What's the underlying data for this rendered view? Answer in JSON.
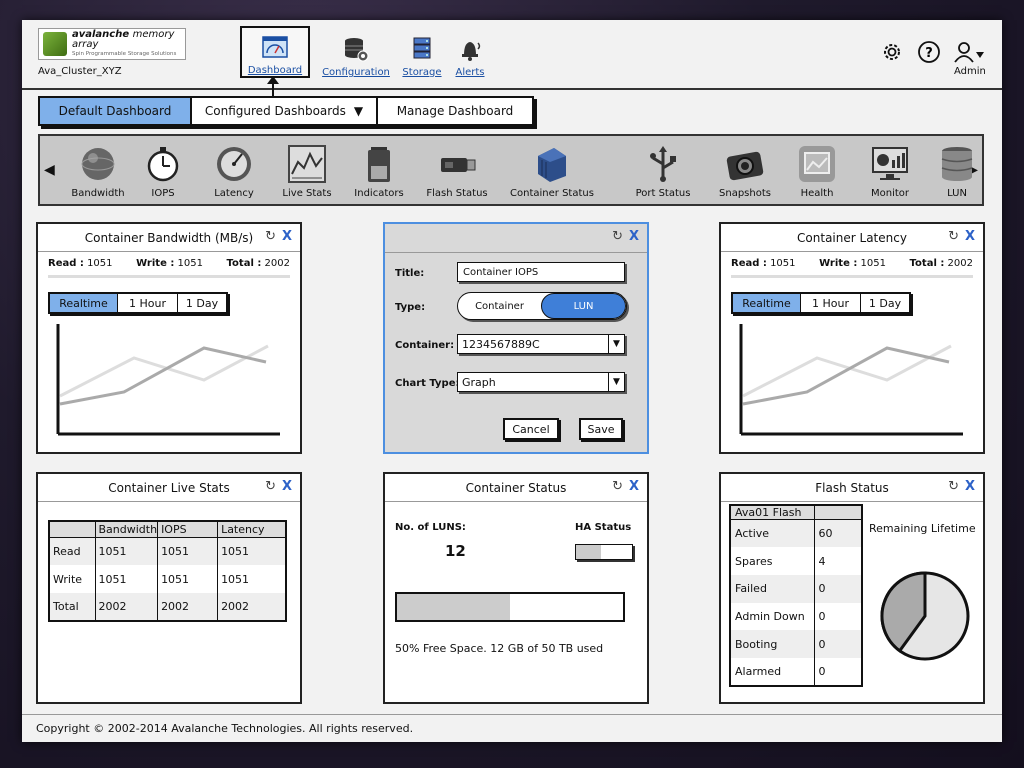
{
  "header": {
    "logo_name": "avalanche",
    "logo_name_suffix": "memory array",
    "logo_tagline": "Spin Programmable Storage Solutions",
    "cluster_name": "Ava_Cluster_XYZ",
    "nav": [
      {
        "label": "Dashboard",
        "icon": "dashboard-icon",
        "active": true
      },
      {
        "label": "Configuration",
        "icon": "database-gear-icon"
      },
      {
        "label": "Storage",
        "icon": "storage-icon"
      },
      {
        "label": "Alerts",
        "icon": "bell-icon"
      }
    ],
    "admin_label": "Admin"
  },
  "tabs": [
    {
      "label": "Default Dashboard",
      "active": true
    },
    {
      "label": "Configured Dashboards",
      "dropdown": true
    },
    {
      "label": "Manage Dashboard"
    }
  ],
  "widgets_bar": [
    {
      "label": "Bandwidth",
      "icon": "sphere-icon"
    },
    {
      "label": "IOPS",
      "icon": "stopwatch-icon"
    },
    {
      "label": "Latency",
      "icon": "gauge-icon"
    },
    {
      "label": "Live Stats",
      "icon": "graph-icon"
    },
    {
      "label": "Indicators",
      "icon": "battery-icon"
    },
    {
      "label": "Flash Status",
      "icon": "usb-drive-icon"
    },
    {
      "label": "Container Status",
      "icon": "container-icon"
    },
    {
      "label": "Port Status",
      "icon": "usb-symbol-icon"
    },
    {
      "label": "Snapshots",
      "icon": "camera-icon"
    },
    {
      "label": "Health",
      "icon": "picture-icon"
    },
    {
      "label": "Monitor",
      "icon": "monitor-chart-icon"
    },
    {
      "label": "LUN",
      "icon": "database-icon"
    }
  ],
  "bandwidth_panel": {
    "title": "Container Bandwidth (MB/s)",
    "read_label": "Read :",
    "read_value": "1051",
    "write_label": "Write :",
    "write_value": "1051",
    "total_label": "Total :",
    "total_value": "2002",
    "ranges": [
      "Realtime",
      "1 Hour",
      "1 Day"
    ]
  },
  "latency_panel": {
    "title": "Container Latency",
    "read_label": "Read :",
    "read_value": "1051",
    "write_label": "Write :",
    "write_value": "1051",
    "total_label": "Total :",
    "total_value": "2002",
    "ranges": [
      "Realtime",
      "1 Hour",
      "1 Day"
    ]
  },
  "config_panel": {
    "title_label": "Title:",
    "title_value": "Container IOPS",
    "type_label": "Type:",
    "type_options": [
      "Container",
      "LUN"
    ],
    "type_selected": "LUN",
    "container_label": "Container:",
    "container_value": "1234567889C",
    "chart_type_label": "Chart Type:",
    "chart_type_value": "Graph",
    "cancel_label": "Cancel",
    "save_label": "Save"
  },
  "live_stats_panel": {
    "title": "Container Live Stats",
    "columns": [
      "",
      "Bandwidth",
      "IOPS",
      "Latency"
    ],
    "rows": [
      [
        "Read",
        "1051",
        "1051",
        "1051"
      ],
      [
        "Write",
        "1051",
        "1051",
        "1051"
      ],
      [
        "Total",
        "2002",
        "2002",
        "2002"
      ]
    ]
  },
  "container_status_panel": {
    "title": "Container Status",
    "luns_label": "No. of LUNS:",
    "luns_value": "12",
    "ha_label": "HA Status",
    "ha_fill": 0.45,
    "space_fill": 0.5,
    "space_text": "50% Free Space. 12 GB of 50 TB used"
  },
  "flash_status_panel": {
    "title": "Flash Status",
    "table_header": "Ava01 Flash",
    "rows": [
      [
        "Active",
        "60"
      ],
      [
        "Spares",
        "4"
      ],
      [
        "Failed",
        "0"
      ],
      [
        "Admin Down",
        "0"
      ],
      [
        "Booting",
        "0"
      ],
      [
        "Alarmed",
        "0"
      ]
    ],
    "lifetime_label": "Remaining Lifetime",
    "lifetime_used_fraction": 0.4
  },
  "footer": {
    "copyright": "Copyright © 2002-2014 Avalanche Technologies. All rights reserved."
  },
  "colors": {
    "accent_blue": "#7fb0ea",
    "toggle_blue": "#3f7fd8",
    "link_blue": "#1a4fa3"
  }
}
